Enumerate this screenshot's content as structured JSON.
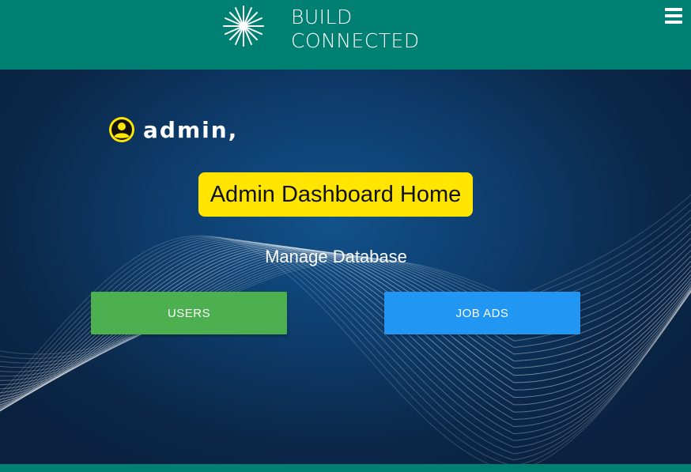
{
  "brand": {
    "line1": "BUILD",
    "line2": "CONNECTED",
    "icon": "starburst-logo-icon"
  },
  "header": {
    "menu_icon": "hamburger-menu-icon"
  },
  "greeting": {
    "user_icon": "user-circle-icon",
    "text": "admin,"
  },
  "page": {
    "title": "Admin Dashboard Home",
    "subtitle": "Manage Database"
  },
  "actions": [
    {
      "label": "USERS",
      "color": "#4caf50"
    },
    {
      "label": "JOB ADS",
      "color": "#2196f3"
    }
  ],
  "colors": {
    "header": "#008073",
    "title_badge": "#ffe500",
    "hero_bg": "#0d3b6a"
  }
}
